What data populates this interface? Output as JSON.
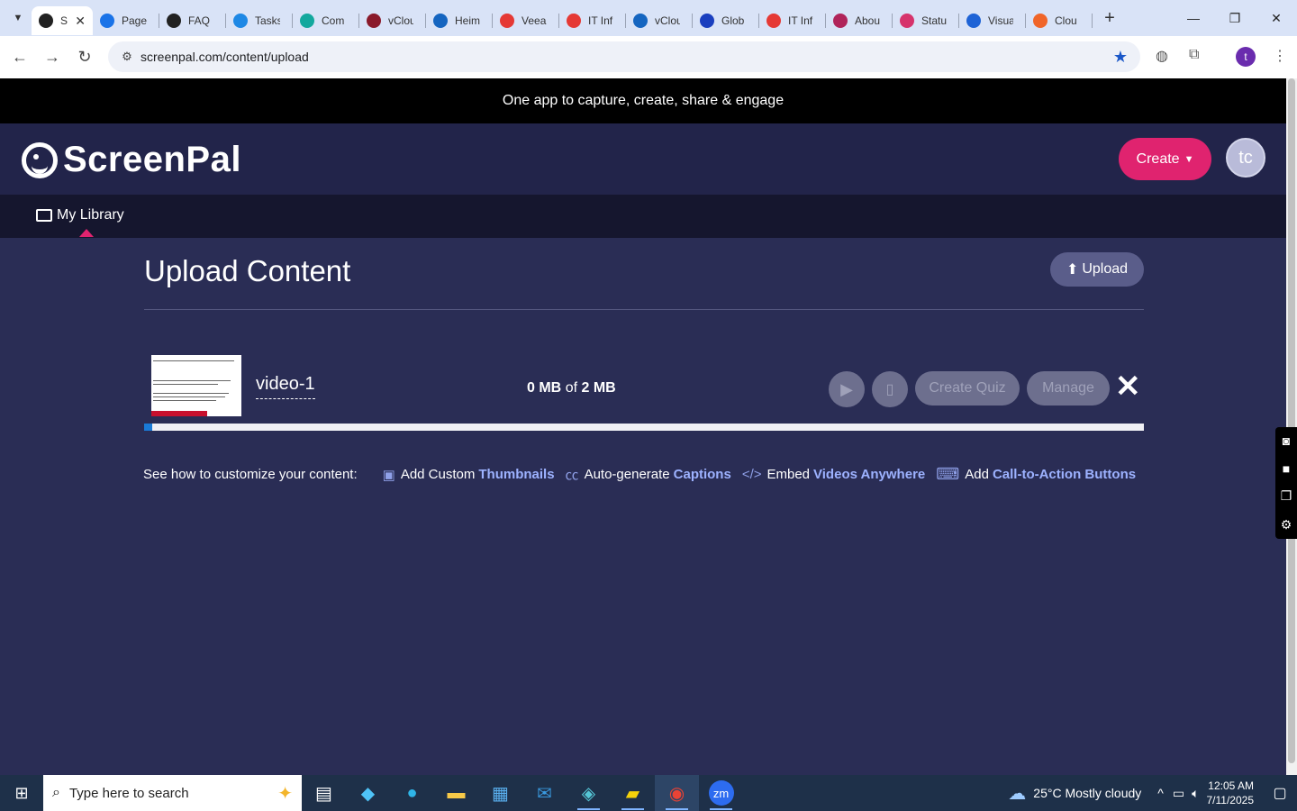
{
  "browser": {
    "active_tab": {
      "title": "S",
      "favicon_color": "#222222"
    },
    "tabs": [
      {
        "title": "Page",
        "favicon_color": "#1a73e8"
      },
      {
        "title": "FAQ",
        "favicon_color": "#222222"
      },
      {
        "title": "Tasks",
        "favicon_color": "#1e88e5"
      },
      {
        "title": "Com",
        "favicon_color": "#13a89e"
      },
      {
        "title": "vClou",
        "favicon_color": "#8a1a2b"
      },
      {
        "title": "Heim",
        "favicon_color": "#1565c0"
      },
      {
        "title": "Veea",
        "favicon_color": "#e53935"
      },
      {
        "title": "IT Inf",
        "favicon_color": "#e53935"
      },
      {
        "title": "vClou",
        "favicon_color": "#1565c0"
      },
      {
        "title": "Glob",
        "favicon_color": "#1a3fbf"
      },
      {
        "title": "IT Inf",
        "favicon_color": "#e53935"
      },
      {
        "title": "Abou",
        "favicon_color": "#b0245a"
      },
      {
        "title": "Statu",
        "favicon_color": "#d6336c"
      },
      {
        "title": "Visua",
        "favicon_color": "#1e63d6"
      },
      {
        "title": "Clou",
        "favicon_color": "#f06529"
      }
    ],
    "url": "screenpal.com/content/upload",
    "profile_initial": "t"
  },
  "page": {
    "banner": "One app to capture, create, share & engage",
    "logo": {
      "part1": "Screen",
      "part2": "Pal"
    },
    "create_label": "Create",
    "avatar_initials": "tc",
    "nav_my_library": "My Library",
    "title": "Upload Content",
    "upload_label": "Upload",
    "item": {
      "name": "video-1",
      "size_current": "0 MB",
      "size_of": "of",
      "size_total": "2 MB",
      "create_quiz": "Create Quiz",
      "manage": "Manage",
      "progress_fraction": 0.008
    },
    "tips": {
      "intro": "See how to customize your content:",
      "t1_pre": "Add Custom",
      "t1_bold": "Thumbnails",
      "t2_pre": "Auto-generate",
      "t2_bold": "Captions",
      "t3_pre": "Embed",
      "t3_bold": "Videos Anywhere",
      "t4_pre": "Add",
      "t4_bold": "Call-to-Action Buttons"
    }
  },
  "taskbar": {
    "search_placeholder": "Type here to search",
    "weather": "25°C  Mostly cloudy",
    "time": "12:05 AM",
    "date": "7/11/2025"
  }
}
